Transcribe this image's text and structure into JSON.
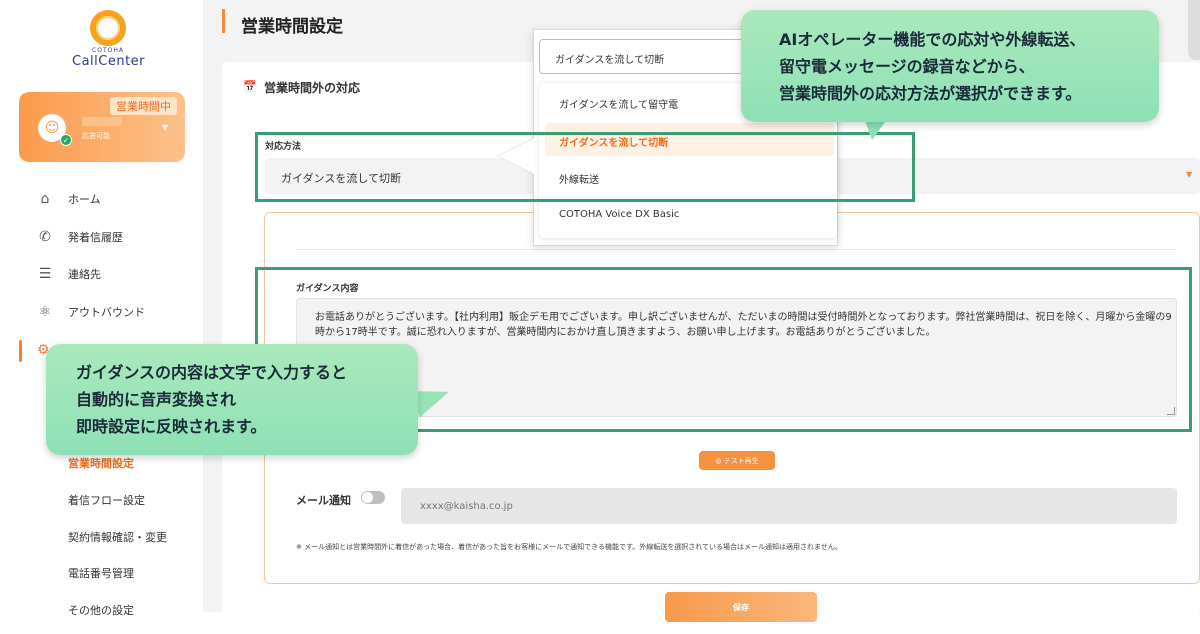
{
  "brand": {
    "logo_sub": "COTOHA",
    "logo_main": "CallCenter"
  },
  "user": {
    "status_tag": "営業時間中",
    "sub_status": "応答可能"
  },
  "nav": {
    "items": [
      {
        "label": "ホーム",
        "icon": "home-icon"
      },
      {
        "label": "発着信履歴",
        "icon": "phone-history-icon"
      },
      {
        "label": "連絡先",
        "icon": "contacts-icon"
      },
      {
        "label": "アウトバウンド",
        "icon": "outbound-icon"
      }
    ],
    "sub_items": [
      {
        "label": "営業時間設定",
        "active": true
      },
      {
        "label": "着信フロー設定",
        "active": false
      },
      {
        "label": "契約情報確認・変更",
        "active": false
      },
      {
        "label": "電話番号管理",
        "active": false
      },
      {
        "label": "その他の設定",
        "active": false
      }
    ]
  },
  "page": {
    "title": "営業時間設定",
    "section_title": "営業時間外の対応"
  },
  "method": {
    "label": "対応方法",
    "value": "ガイダンスを流して切断"
  },
  "dropdown": {
    "selected": "ガイダンスを流して切断",
    "options": [
      {
        "label": "ガイダンスを流して留守電",
        "selected": false
      },
      {
        "label": "ガイダンスを流して切断",
        "selected": true
      },
      {
        "label": "外線転送",
        "selected": false
      },
      {
        "label": "COTOHA Voice DX Basic",
        "selected": false
      }
    ]
  },
  "guidance": {
    "label": "ガイダンス内容",
    "text": "お電話ありがとうございます。【社内利用】販企デモ用でございます。申し訳ございませんが、ただいまの時間は受付時間外となっております。弊社営業時間は、祝日を除く、月曜から金曜の9時から17時半です。誠に恐れ入りますが、営業時間内におかけ直し頂きますよう、お願い申し上げます。お電話ありがとうございました。",
    "test_button": "◎ テスト再生"
  },
  "mail": {
    "label": "メール通知",
    "placeholder": "xxxx@kaisha.co.jp",
    "note": "※ メール通知とは営業時間外に着信があった場合、着信があった旨をお客様にメールで通知できる機能です。外線転送を選択されている場合はメール通知は適用されません。",
    "enabled": false
  },
  "save_button": "保存",
  "callouts": {
    "top": [
      "AIオペレーター機能での応対や外線転送、",
      "留守電メッセージの録音などから、",
      "営業時間外の応対方法が選択ができます。"
    ],
    "left": [
      "ガイダンスの内容は文字で入力すると",
      "自動的に音声変換され",
      "即時設定に反映されます。"
    ]
  },
  "colors": {
    "accent": "#f28b3a",
    "highlight_frame": "#3a9d73",
    "callout_bg": "#a9e9bc"
  }
}
